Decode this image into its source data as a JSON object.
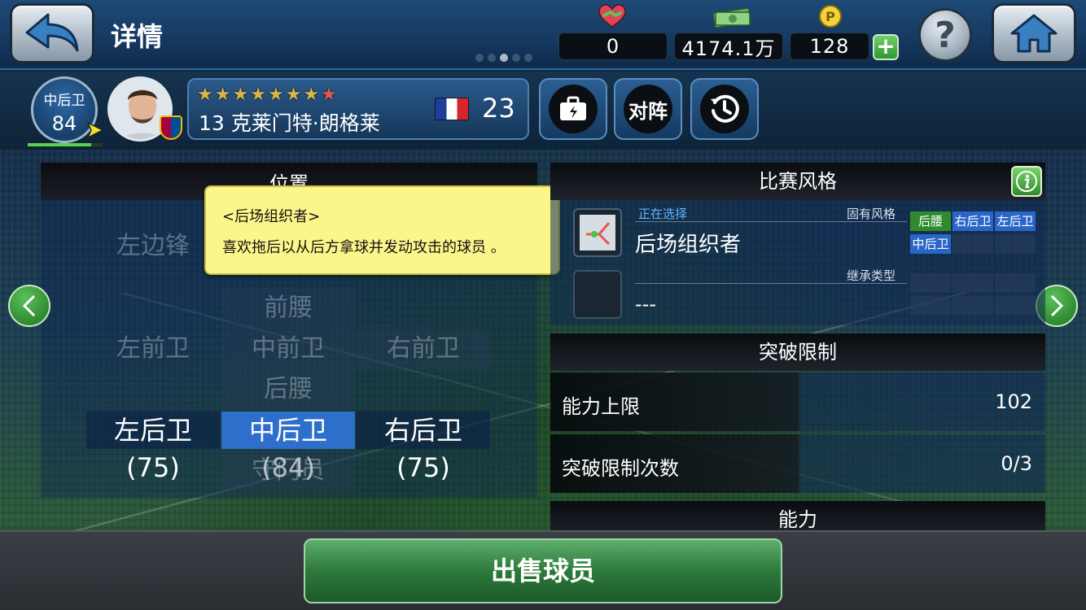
{
  "header": {
    "title": "详情",
    "resources": {
      "friendship": "0",
      "money": "4174.1万",
      "coins": "128"
    }
  },
  "player": {
    "position_abbr": "中后卫",
    "rating": "84",
    "name": "13 克莱门特·朗格莱",
    "age": "23",
    "stars": [
      {
        "color": "#d9b44a"
      },
      {
        "color": "#d9b44a"
      },
      {
        "color": "#d9b44a"
      },
      {
        "color": "#d9b44a"
      },
      {
        "color": "#d9b44a"
      },
      {
        "color": "#d9b44a"
      },
      {
        "color": "#d9b44a"
      },
      {
        "color": "#e05a4a"
      }
    ],
    "flag": "france",
    "club": "barcelona"
  },
  "actions": {
    "lineup_label": "对阵"
  },
  "positions": {
    "title": "位置",
    "left_wing": "左边锋",
    "am": "前腰",
    "lcm": "左前卫",
    "cm": "中前卫",
    "rcm": "右前卫",
    "dm": "后腰",
    "lb": "左后卫 (75)",
    "cb": "中后卫 (84)",
    "rb": "右后卫 (75)",
    "gk": "守门员"
  },
  "tooltip": {
    "title": "<后场组织者>",
    "text": "喜欢拖后以从后方拿球并发动攻击的球员 。"
  },
  "play_style": {
    "title": "比赛风格",
    "selecting_label": "正在选择",
    "current_style": "后场组织者",
    "inherent_label": "固有风格",
    "inherent_tags": [
      "后腰",
      "右后卫",
      "左后卫",
      "中后卫"
    ],
    "inherited_label": "继承类型",
    "inherited_value": "---"
  },
  "limit_break": {
    "title": "突破限制",
    "ability_cap_label": "能力上限",
    "ability_cap_value": "102",
    "breaks_label": "突破限制次数",
    "breaks_value": "0/3"
  },
  "ability": {
    "title": "能力"
  },
  "footer": {
    "sell_label": "出售球员"
  }
}
